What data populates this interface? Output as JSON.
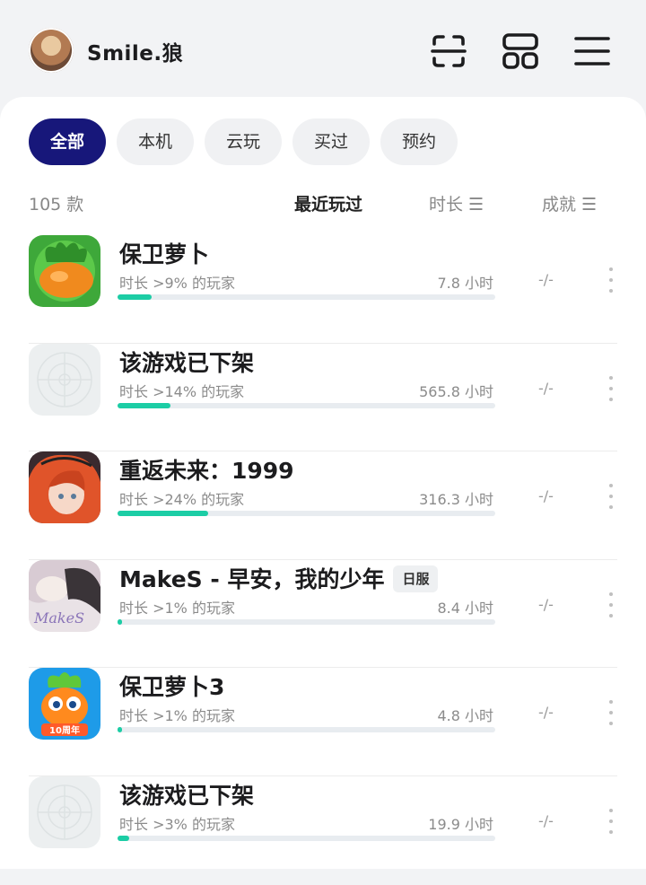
{
  "header": {
    "username": "Smile.狼",
    "icons": [
      "scan-icon",
      "grid-icon",
      "menu-icon"
    ]
  },
  "tabs": [
    {
      "label": "全部",
      "active": true
    },
    {
      "label": "本机",
      "active": false
    },
    {
      "label": "云玩",
      "active": false
    },
    {
      "label": "买过",
      "active": false
    },
    {
      "label": "预约",
      "active": false
    }
  ],
  "list_header": {
    "count": "105 款",
    "sort_recent": "最近玩过",
    "sort_duration": "时长 ☰",
    "sort_achievement": "成就 ☰"
  },
  "games": [
    {
      "title": "保卫萝卜",
      "tag": "",
      "stat": "时长 >9% 的玩家",
      "hours": "7.8 小时",
      "achievement": "-/-",
      "progress": 0.09,
      "icon": "carrot-icon"
    },
    {
      "title": "该游戏已下架",
      "tag": "",
      "stat": "时长 >14% 的玩家",
      "hours": "565.8 小时",
      "achievement": "-/-",
      "progress": 0.14,
      "icon": "placeholder-icon"
    },
    {
      "title": "重返未来：1999",
      "tag": "",
      "stat": "时长 >24% 的玩家",
      "hours": "316.3 小时",
      "achievement": "-/-",
      "progress": 0.24,
      "icon": "anime-girl-icon"
    },
    {
      "title": "MakeS - 早安，我的少年",
      "tag": "日服",
      "stat": "时长 >1% 的玩家",
      "hours": "8.4 小时",
      "achievement": "-/-",
      "progress": 0.01,
      "icon": "makes-icon"
    },
    {
      "title": "保卫萝卜3",
      "tag": "",
      "stat": "时长 >1% 的玩家",
      "hours": "4.8 小时",
      "achievement": "-/-",
      "progress": 0.01,
      "icon": "carrot3-icon"
    },
    {
      "title": "该游戏已下架",
      "tag": "",
      "stat": "时长 >3% 的玩家",
      "hours": "19.9 小时",
      "achievement": "-/-",
      "progress": 0.03,
      "icon": "placeholder-icon"
    }
  ],
  "colors": {
    "accent": "#17177a",
    "progress": "#1ccda5"
  }
}
